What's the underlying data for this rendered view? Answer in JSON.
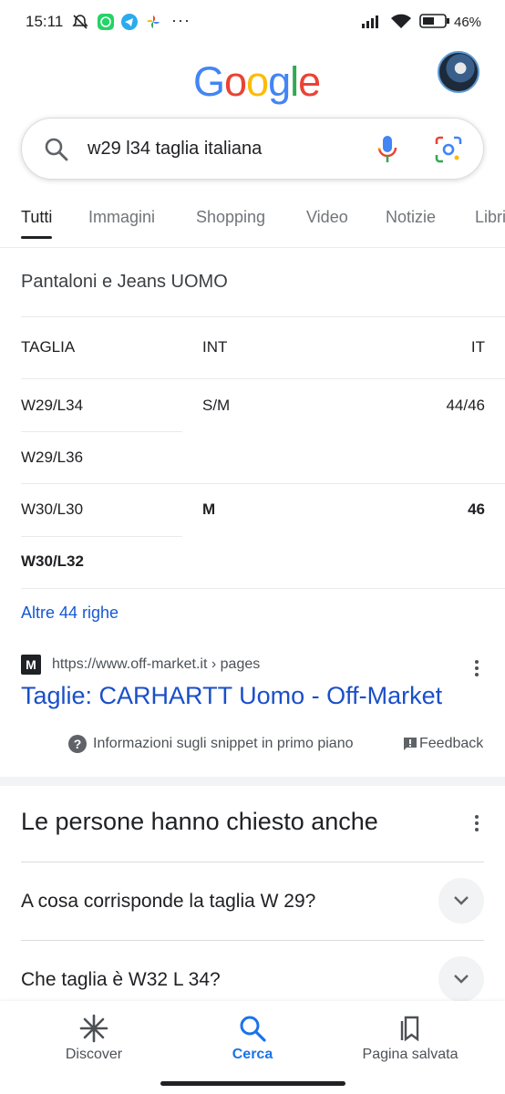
{
  "status_bar": {
    "time": "15:11",
    "battery": "46%",
    "icons": [
      "muted-icon",
      "whatsapp-icon",
      "telegram-icon",
      "photos-icon",
      "more-dots-icon",
      "signal-icon",
      "wifi-icon",
      "battery-icon"
    ]
  },
  "header": {
    "logo_letters": [
      {
        "ch": "G",
        "color": "#4285F4"
      },
      {
        "ch": "o",
        "color": "#EA4335"
      },
      {
        "ch": "o",
        "color": "#FBBC05"
      },
      {
        "ch": "g",
        "color": "#4285F4"
      },
      {
        "ch": "l",
        "color": "#34A853"
      },
      {
        "ch": "e",
        "color": "#EA4335"
      }
    ]
  },
  "search": {
    "query": "w29 l34 taglia italiana"
  },
  "tabs": [
    "Tutti",
    "Immagini",
    "Shopping",
    "Video",
    "Notizie",
    "Libri"
  ],
  "active_tab": "Tutti",
  "snippet": {
    "title": "Pantaloni e Jeans UOMO",
    "table": {
      "headers": [
        "TAGLIA",
        "INT",
        "IT"
      ],
      "rows": [
        {
          "taglia": "W29/L34",
          "int": "S/M",
          "it": "44/46"
        },
        {
          "taglia": "W29/L36",
          "int": "",
          "it": ""
        },
        {
          "taglia": "W30/L30",
          "int": "M",
          "it": "46"
        },
        {
          "taglia": "W30/L32",
          "int": "",
          "it": ""
        }
      ]
    },
    "more_rows": "Altre 44 righe",
    "source_favicon": "M",
    "source_url": "https://www.off-market.it › pages",
    "result_title": "Taglie: CARHARTT Uomo - Off-Market",
    "info_text": "Informazioni sugli snippet in primo piano",
    "feedback_text": "Feedback"
  },
  "paa": {
    "title": "Le persone hanno chiesto anche",
    "questions": [
      "A cosa corrisponde la taglia W 29?",
      "Che taglia è W32 L 34?"
    ]
  },
  "bottom_nav": {
    "items": [
      "Discover",
      "Cerca",
      "Pagina salvata"
    ],
    "active": "Cerca"
  },
  "colors": {
    "link": "#1a4fc9",
    "active_nav": "#1a73e8",
    "text": "#202124"
  }
}
